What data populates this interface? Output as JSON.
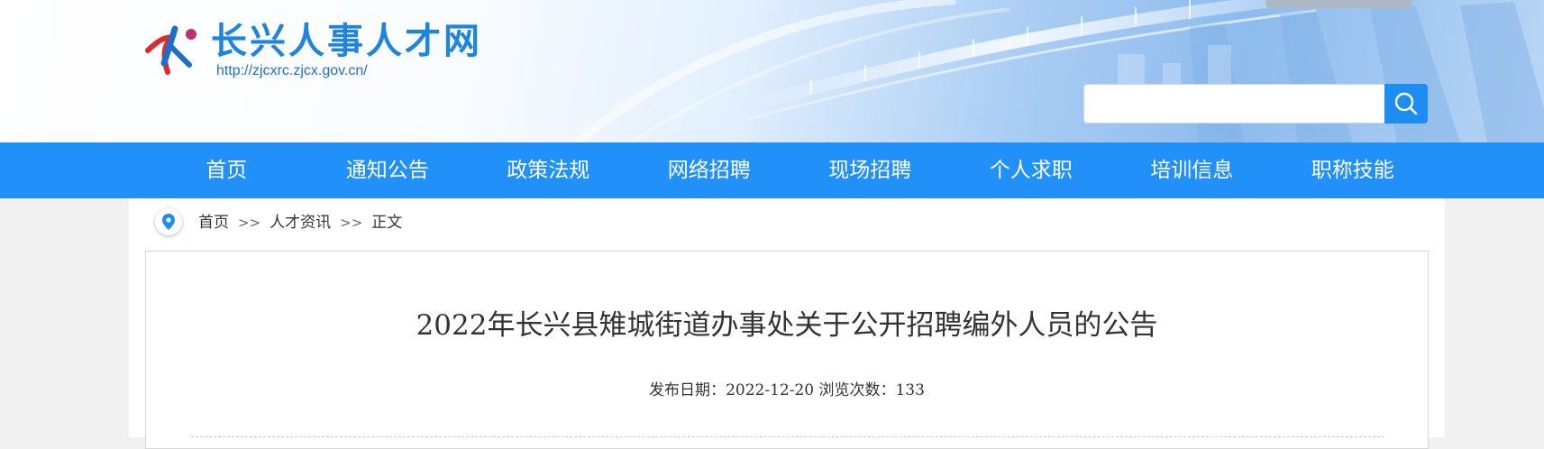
{
  "header": {
    "site_title": "长兴人事人才网",
    "site_url": "http://zjcxrc.zjcx.gov.cn/",
    "search": {
      "placeholder": "",
      "value": ""
    }
  },
  "nav": {
    "items": [
      "首页",
      "通知公告",
      "政策法规",
      "网络招聘",
      "现场招聘",
      "个人求职",
      "培训信息",
      "职称技能"
    ]
  },
  "breadcrumb": {
    "items": [
      "首页",
      "人才资讯",
      "正文"
    ],
    "separator": ">>"
  },
  "article": {
    "title": "2022年长兴县雉城街道办事处关于公开招聘编外人员的公告",
    "date_label": "发布日期：",
    "date": "2022-12-20",
    "views_label": "浏览次数：",
    "views": "133"
  },
  "colors": {
    "nav_bg": "#2190f8",
    "brand": "#1f84df",
    "search_button": "#1e8df2",
    "page_bg": "#f1f1f1"
  },
  "icons": [
    "logo-mark-icon",
    "search-icon",
    "location-pin-icon"
  ]
}
